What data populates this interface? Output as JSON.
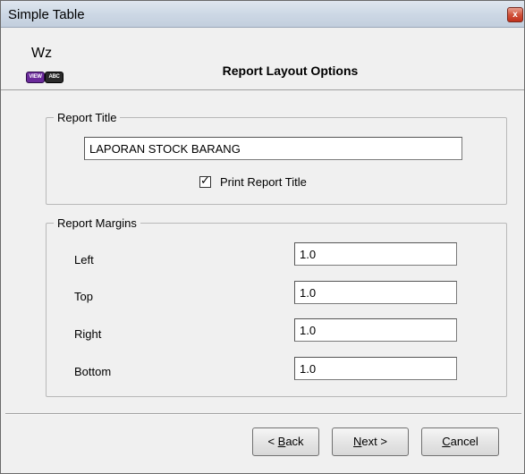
{
  "window": {
    "title": "Simple Table",
    "close_glyph": "x"
  },
  "header": {
    "title": "Report Layout Options",
    "logo": {
      "text": "Wz",
      "badge_left": "VIEW",
      "badge_right": "ABC",
      "icon": "wizard-logo-icon"
    }
  },
  "report_title_group": {
    "legend": "Report Title",
    "title_value": "LAPORAN STOCK BARANG",
    "print_checkbox": {
      "label": "Print Report Title",
      "checked": true
    }
  },
  "margins_group": {
    "legend": "Report Margins",
    "fields": [
      {
        "label": "Left",
        "value": "1.0"
      },
      {
        "label": "Top",
        "value": "1.0"
      },
      {
        "label": "Right",
        "value": "1.0"
      },
      {
        "label": "Bottom",
        "value": "1.0"
      }
    ]
  },
  "buttons": {
    "back": {
      "prefix": "< ",
      "mnemonic": "B",
      "rest": "ack"
    },
    "next": {
      "mnemonic": "N",
      "rest": "ext >"
    },
    "cancel": {
      "mnemonic": "C",
      "rest": "ancel"
    }
  },
  "colors": {
    "titlebar": "#cdd8e5",
    "close": "#c0301c",
    "dialog_bg": "#f0f0f0"
  }
}
